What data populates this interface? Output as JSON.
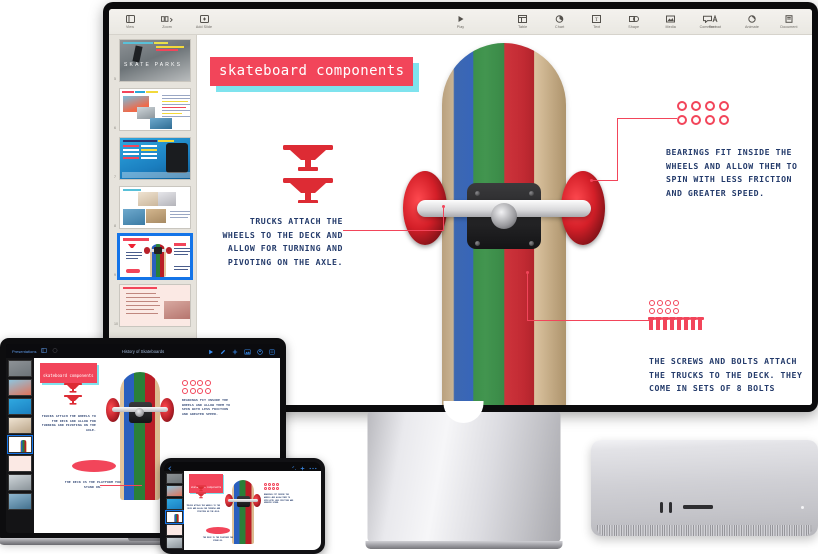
{
  "scene": {
    "devices": [
      "studio-display",
      "macbook",
      "iphone",
      "display-stand",
      "mac-studio"
    ]
  },
  "keynote": {
    "toolbar_left": [
      {
        "label": "View",
        "icon": "view-icon"
      },
      {
        "label": "Zoom",
        "icon": "zoom-icon"
      },
      {
        "label": "Add Slide",
        "icon": "add-slide-icon"
      }
    ],
    "toolbar_center": [
      {
        "label": "Play",
        "icon": "play-icon"
      }
    ],
    "toolbar_mid": [
      {
        "label": "Table",
        "icon": "table-icon"
      },
      {
        "label": "Chart",
        "icon": "chart-icon"
      },
      {
        "label": "Text",
        "icon": "text-icon"
      },
      {
        "label": "Shape",
        "icon": "shape-icon"
      },
      {
        "label": "Media",
        "icon": "media-icon"
      },
      {
        "label": "Comment",
        "icon": "comment-icon"
      }
    ],
    "toolbar_right": [
      {
        "label": "Format",
        "icon": "format-icon"
      },
      {
        "label": "Animate",
        "icon": "animate-icon"
      },
      {
        "label": "Document",
        "icon": "document-icon"
      }
    ],
    "navigator": {
      "slides": [
        {
          "number": "5",
          "name": "skate-parks",
          "selected": false
        },
        {
          "number": "6",
          "name": "tricks-photos",
          "selected": false
        },
        {
          "number": "7",
          "name": "timeline-blue",
          "selected": false
        },
        {
          "number": "8",
          "name": "gear-collage",
          "selected": false
        },
        {
          "number": "9",
          "name": "skateboard-components",
          "selected": true
        },
        {
          "number": "10",
          "name": "safety-text",
          "selected": false
        }
      ]
    }
  },
  "slide": {
    "title": "skateboard components",
    "callouts": [
      {
        "name": "trucks",
        "text": "TRUCKS ATTACH THE WHEELS TO THE DECK AND ALLOW FOR TURNING AND PIVOTING ON THE AXLE.",
        "align": "right"
      },
      {
        "name": "bearings",
        "text": "BEARINGS FIT INSIDE THE WHEELS AND ALLOW THEM TO SPIN WITH LESS FRICTION AND GREATER SPEED.",
        "align": "left"
      },
      {
        "name": "screws-and-bolts",
        "text": "THE SCREWS AND BOLTS ATTACH THE TRUCKS TO THE DECK. THEY COME IN SETS OF 8 BOLTS",
        "align": "left"
      },
      {
        "name": "deck",
        "text": "THE DECK IS THE PLATFORM YOU STAND ON.",
        "align": "left"
      }
    ],
    "graphics": {
      "trucks_count": 2,
      "bearing_rings": 8,
      "nuts": 8,
      "bolts": 8
    },
    "colors": {
      "accent_red": "#f2455a",
      "title_shadow_cyan": "#7fe3ee",
      "body_navy": "#243b6b",
      "deck_blue": "#2a5fbe",
      "deck_green": "#2a8038",
      "deck_red": "#b91d26",
      "deck_wood": "#e2c49a"
    }
  },
  "laptop": {
    "toolbar": {
      "left_label": "Presentations",
      "title": "History of Skateboards",
      "right_icons": [
        "play-icon",
        "pen-icon",
        "add-icon",
        "media-icon",
        "collaborate-icon",
        "format-icon"
      ],
      "left_icons": [
        "view-icon",
        "zoom-icon"
      ]
    }
  },
  "phone": {
    "toolbar": {
      "right_icons": [
        "undo-icon",
        "add-icon",
        "more-icon"
      ]
    }
  }
}
